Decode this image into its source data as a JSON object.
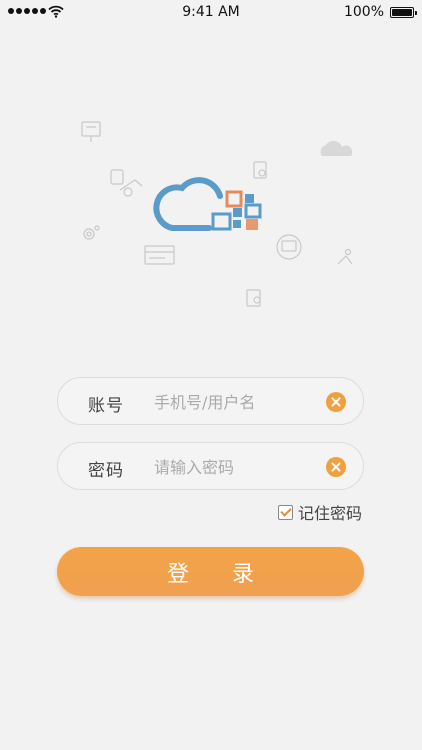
{
  "status_bar": {
    "time": "9:41 AM",
    "battery_percent": "100%",
    "icons": [
      "signal-icon",
      "wifi-icon",
      "battery-icon"
    ]
  },
  "illustration": {
    "icons": [
      "cloud-logo-icon",
      "cloud-icon",
      "document-icon",
      "gear-icon",
      "card-icon",
      "map-pin-icon",
      "id-card-icon"
    ]
  },
  "login_form": {
    "account": {
      "label": "账号",
      "placeholder": "手机号/用户名",
      "value": ""
    },
    "password": {
      "label": "密码",
      "placeholder": "请输入密码",
      "value": ""
    },
    "remember_label": "记住密码",
    "remember_checked": true,
    "submit_label": "登 录"
  },
  "colors": {
    "background": "#f2f2f2",
    "accent": "#f0a040",
    "logo_blue": "#5b9bc9",
    "logo_orange": "#e8895a"
  }
}
